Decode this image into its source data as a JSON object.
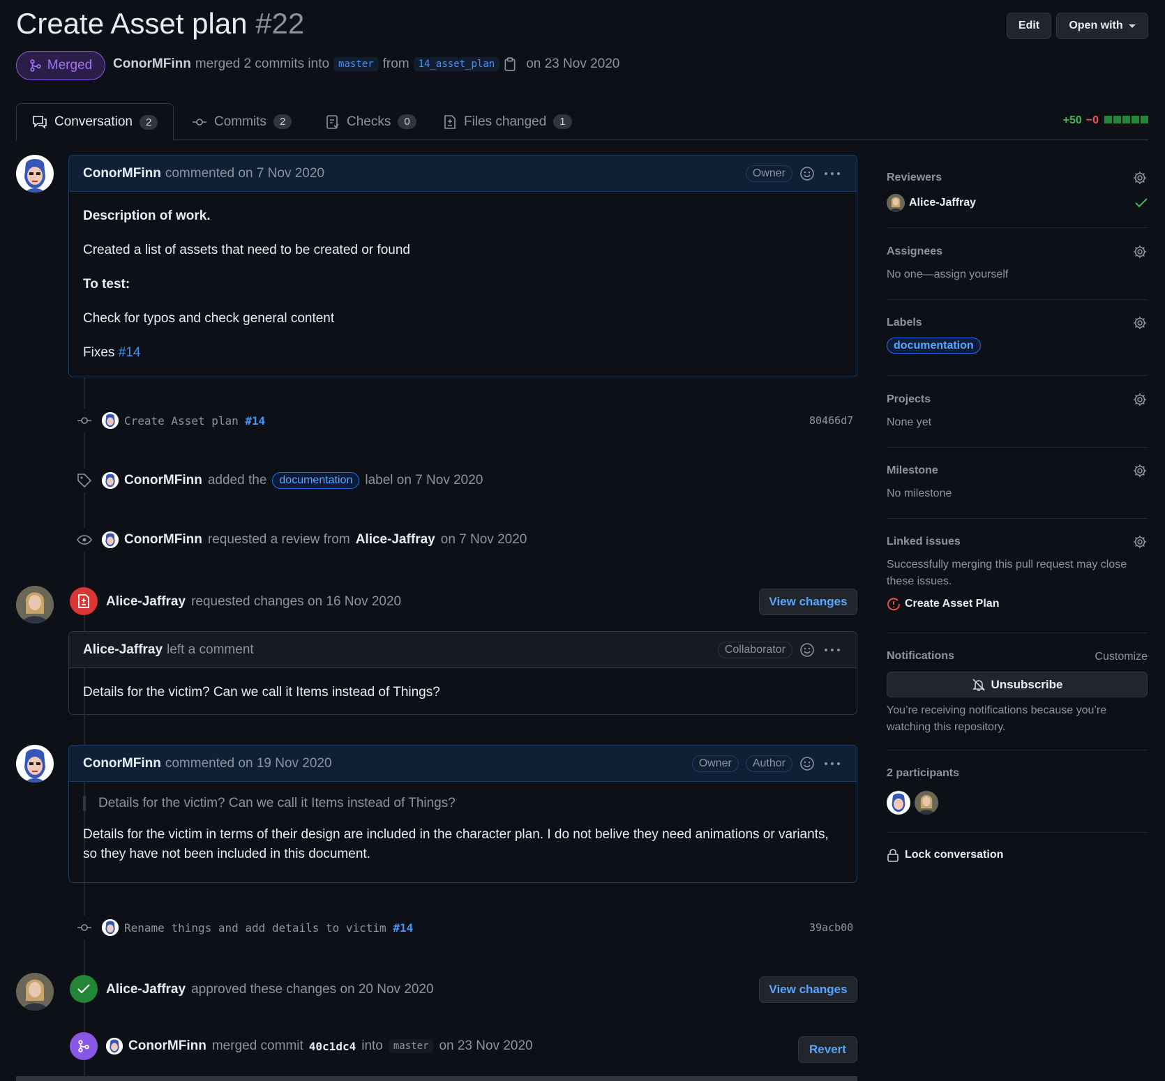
{
  "header": {
    "title": "Create Asset plan",
    "number": "#22",
    "edit_label": "Edit",
    "open_with_label": "Open with",
    "state_label": "Merged",
    "author": "ConorMFinn",
    "merged_text": "merged 2 commits into",
    "base_branch": "master",
    "from_text": "from",
    "head_branch": "14_asset_plan",
    "date_text": "on 23 Nov 2020"
  },
  "tabs": [
    {
      "label": "Conversation",
      "count": "2"
    },
    {
      "label": "Commits",
      "count": "2"
    },
    {
      "label": "Checks",
      "count": "0"
    },
    {
      "label": "Files changed",
      "count": "1"
    }
  ],
  "diffstat": {
    "additions": "+50",
    "deletions": "−0"
  },
  "timeline": {
    "comment1": {
      "author": "ConorMFinn",
      "meta": "commented on 7 Nov 2020",
      "badge": "Owner",
      "heading": "Description of work.",
      "line1": "Created a list of assets that need to be created or found",
      "heading2": "To test:",
      "line2": "Check for typos and check general content",
      "fixes_text": "Fixes",
      "fixes_ref": "#14"
    },
    "commit1": {
      "message": "Create Asset plan",
      "ref": "#14",
      "sha": "80466d7"
    },
    "label_event": {
      "actor": "ConorMFinn",
      "pre": "added the",
      "label": "documentation",
      "post": "label on 7 Nov 2020"
    },
    "review_request": {
      "actor": "ConorMFinn",
      "pre": "requested a review from",
      "reviewer": "Alice-Jaffray",
      "post": "on 7 Nov 2020"
    },
    "changes_requested": {
      "actor": "Alice-Jaffray",
      "text": "requested changes on 16 Nov 2020",
      "button": "View changes"
    },
    "review_comment": {
      "author": "Alice-Jaffray",
      "meta": "left a comment",
      "badge": "Collaborator",
      "body": "Details for the victim? Can we call it Items instead of Things?"
    },
    "comment2": {
      "author": "ConorMFinn",
      "meta": "commented on 19 Nov 2020",
      "badge1": "Owner",
      "badge2": "Author",
      "quote": "Details for the victim? Can we call it Items instead of Things?",
      "body": "Details for the victim in terms of their design are included in the character plan. I do not belive they need animations or variants, so they have not been included in this document."
    },
    "commit2": {
      "message": "Rename things and add details to victim",
      "ref": "#14",
      "sha": "39acb00"
    },
    "approved": {
      "actor": "Alice-Jaffray",
      "text": "approved these changes on 20 Nov 2020",
      "button": "View changes"
    },
    "merged": {
      "actor": "ConorMFinn",
      "pre": "merged commit",
      "sha": "40c1dc4",
      "into": "into",
      "branch": "master",
      "post": "on 23 Nov 2020",
      "button": "Revert"
    }
  },
  "sidebar": {
    "reviewers": {
      "title": "Reviewers",
      "name": "Alice-Jaffray"
    },
    "assignees": {
      "title": "Assignees",
      "text": "No one—assign yourself"
    },
    "labels": {
      "title": "Labels",
      "label": "documentation"
    },
    "projects": {
      "title": "Projects",
      "text": "None yet"
    },
    "milestone": {
      "title": "Milestone",
      "text": "No milestone"
    },
    "linked": {
      "title": "Linked issues",
      "text": "Successfully merging this pull request may close these issues.",
      "issue": "Create Asset Plan"
    },
    "notifications": {
      "title": "Notifications",
      "customize": "Customize",
      "button": "Unsubscribe",
      "text": "You’re receiving notifications because you’re watching this repository."
    },
    "participants": {
      "title": "2 participants"
    },
    "lock": "Lock conversation"
  }
}
